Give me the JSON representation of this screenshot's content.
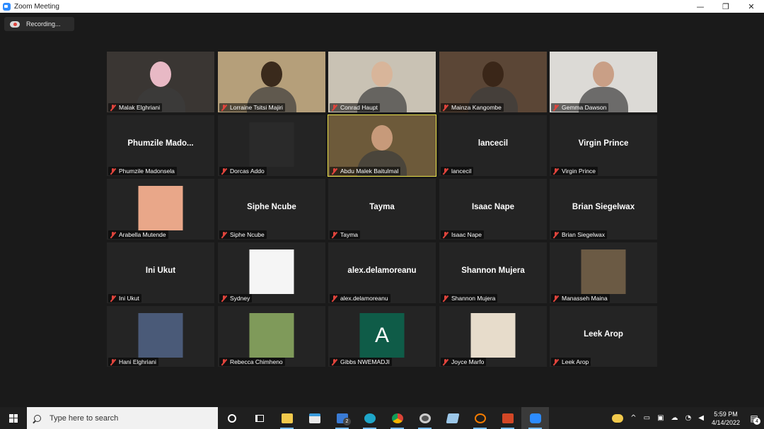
{
  "window": {
    "title": "Zoom Meeting",
    "minimize": "—",
    "maximize": "❐",
    "close": "✕"
  },
  "recording": {
    "label": "Recording..."
  },
  "participants": [
    {
      "name": "Malak Elghriani",
      "video": true,
      "bg": "#3a3633",
      "skin": "#e8b9c5"
    },
    {
      "name": "Lorraine Tsitsi Majiri",
      "video": true,
      "bg": "#b59f7a",
      "skin": "#3a2a1c"
    },
    {
      "name": "Conrad Haupt",
      "video": true,
      "bg": "#c9c2b4",
      "skin": "#d8b59a"
    },
    {
      "name": "Mainza Kangombe",
      "video": true,
      "bg": "#5b4636",
      "skin": "#3a2618"
    },
    {
      "name": "Gemma Dawson",
      "video": true,
      "bg": "#dcdad6",
      "skin": "#c99f86"
    },
    {
      "name": "Phumzile Madonsela",
      "display": "Phumzile  Mado..."
    },
    {
      "name": "Dorcas Addo",
      "photo": "#2a2a2a"
    },
    {
      "name": "Abdu Malek Baitulmal",
      "video": true,
      "active": true,
      "bg": "#6d5a3a",
      "skin": "#c79a7a"
    },
    {
      "name": "lancecil",
      "display": "lancecil"
    },
    {
      "name": "Virgin Prince",
      "display": "Virgin Prince"
    },
    {
      "name": "Arabella Mutende",
      "photo": "#e9a789"
    },
    {
      "name": "Siphe Ncube",
      "display": "Siphe Ncube"
    },
    {
      "name": "Tayma",
      "display": "Tayma"
    },
    {
      "name": "Isaac Nape",
      "display": "Isaac Nape"
    },
    {
      "name": "Brian Siegelwax",
      "display": "Brian Siegelwax"
    },
    {
      "name": "Ini Ukut",
      "display": "Ini Ukut"
    },
    {
      "name": "Sydney",
      "photo": "#f5f5f5"
    },
    {
      "name": "alex.delamoreanu",
      "display": "alex.delamoreanu"
    },
    {
      "name": "Shannon Mujera",
      "display": "Shannon Mujera"
    },
    {
      "name": "Manasseh Maina",
      "photo": "#6b5a44"
    },
    {
      "name": "Hani Elghriani",
      "photo": "#4a5a78"
    },
    {
      "name": "Rebecca Chimheno",
      "photo": "#7f9a5a"
    },
    {
      "name": "Gibbs NWEMADJI",
      "letter": "A"
    },
    {
      "name": "Joyce Marfo",
      "photo": "#e7dccb"
    },
    {
      "name": "Leek Arop",
      "display": "Leek Arop"
    }
  ],
  "taskbar": {
    "search_placeholder": "Type here to search",
    "time": "5:59 PM",
    "date": "4/14/2022",
    "mail_badge": "2",
    "notif_badge": "4"
  }
}
